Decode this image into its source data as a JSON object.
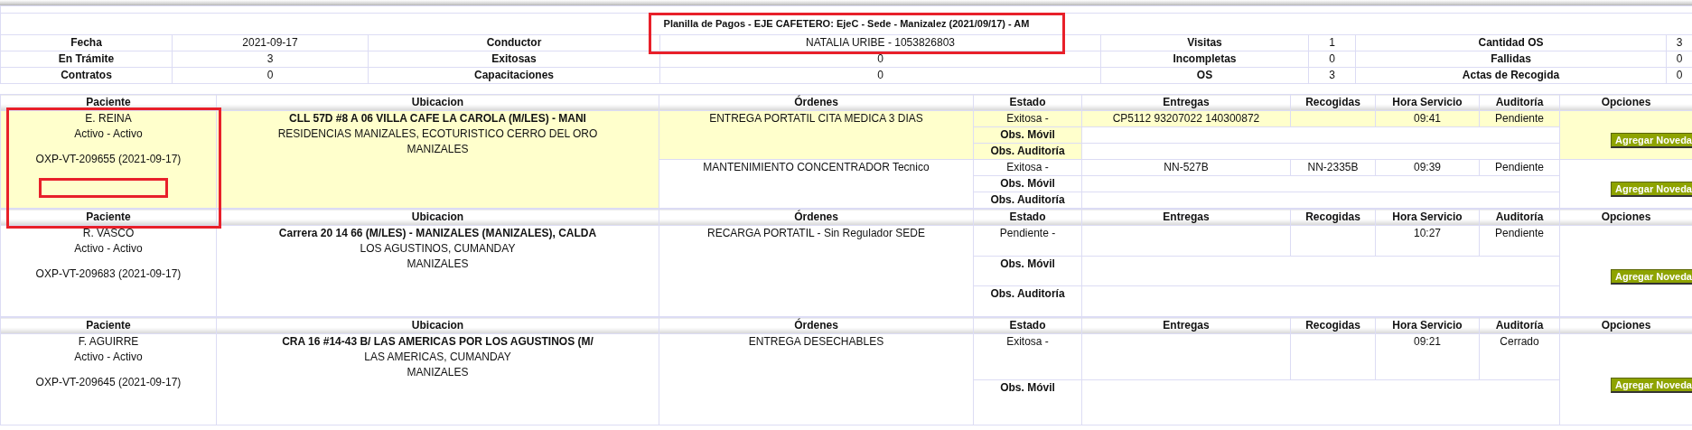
{
  "title": "Planilla de Pagos - EJE CAFETERO: EjeC - Sede - Manizalez (2021/09/17) - AM",
  "summary": [
    [
      {
        "label": "Fecha",
        "value": "2021-09-17"
      },
      {
        "label": "Conductor",
        "value": "NATALIA URIBE - 1053826803"
      },
      {
        "label": "Visitas",
        "value": "1"
      },
      {
        "label": "Cantidad OS",
        "value": "3"
      }
    ],
    [
      {
        "label": "En Trámite",
        "value": "3"
      },
      {
        "label": "Exitosas",
        "value": "0"
      },
      {
        "label": "Incompletas",
        "value": "0"
      },
      {
        "label": "Fallidas",
        "value": "0"
      }
    ],
    [
      {
        "label": "Contratos",
        "value": "0"
      },
      {
        "label": "Capacitaciones",
        "value": "0"
      },
      {
        "label": "OS",
        "value": "3"
      },
      {
        "label": "Actas de Recogida",
        "value": "0"
      }
    ]
  ],
  "groups": [
    {
      "highlighted": true,
      "columns": [
        "Paciente",
        "Ubicacion",
        "Órdenes",
        "Estado",
        "Entregas",
        "Recogidas",
        "Hora Servicio",
        "Auditoría",
        "Opciones"
      ],
      "patient": {
        "name": "E. REINA",
        "status": "Activo - Activo",
        "code": "OXP-VT-209655 (2021-09-17)"
      },
      "location": {
        "address": "CLL 57D #8 A 06 VILLA CAFE LA CAROLA (M/LES) - MANI",
        "area": "RESIDENCIAS MANIZALES, ECOTURISTICO CERRO DEL ORO",
        "city": "MANIZALES"
      },
      "orders": [
        {
          "highlighted": true,
          "description": "ENTREGA PORTATIL CITA MEDICA 3 DIAS",
          "estado": "Exitosa -",
          "entregas": "CP5112 93207022 140300872",
          "hora": "09:41",
          "auditoria": "Pendiente",
          "observations": [
            "Obs. Móvil",
            "Obs. Auditoría"
          ],
          "button": "Agregar Noveda"
        },
        {
          "highlighted": false,
          "description": "MANTENIMIENTO CONCENTRADOR Tecnico",
          "estado": "Exitosa -",
          "entregas": "NN-527B",
          "recogidas": "NN-2335B",
          "hora": "09:39",
          "auditoria": "Pendiente",
          "observations": [
            "Obs. Móvil",
            "Obs. Auditoría"
          ],
          "button": "Agregar Noveda"
        }
      ]
    },
    {
      "highlighted": false,
      "columns": [
        "Paciente",
        "Ubicacion",
        "Órdenes",
        "Estado",
        "Entregas",
        "Recogidas",
        "Hora Servicio",
        "Auditoría",
        "Opciones"
      ],
      "patient": {
        "name": "R. VASCO",
        "status": "Activo - Activo",
        "code": "OXP-VT-209683 (2021-09-17)"
      },
      "location": {
        "address": "Carrera 20 14 66 (M/LES) - MANIZALES (MANIZALES), CALDA",
        "area": "LOS AGUSTINOS, CUMANDAY",
        "city": "MANIZALES"
      },
      "orders": [
        {
          "highlighted": false,
          "description": "RECARGA PORTATIL - Sin Regulador SEDE",
          "estado": "Pendiente -",
          "hora": "10:27",
          "auditoria": "Pendiente",
          "observations": [
            "Obs. Móvil",
            "Obs. Auditoría"
          ],
          "button": "Agregar Noveda"
        }
      ]
    },
    {
      "highlighted": false,
      "columns": [
        "Paciente",
        "Ubicacion",
        "Órdenes",
        "Estado",
        "Entregas",
        "Recogidas",
        "Hora Servicio",
        "Auditoría",
        "Opciones"
      ],
      "patient": {
        "name": "F. AGUIRRE",
        "status": "Activo - Activo",
        "code": "OXP-VT-209645 (2021-09-17)"
      },
      "location": {
        "address": "CRA 16 #14-43 B/ LAS AMERICAS POR LOS AGUSTINOS (M/",
        "area": "LAS AMERICAS, CUMANDAY",
        "city": "MANIZALES"
      },
      "orders": [
        {
          "highlighted": false,
          "description": "ENTREGA DESECHABLES",
          "estado": "Exitosa -",
          "hora": "09:21",
          "auditoria": "Cerrado",
          "observations": [
            "Obs. Móvil"
          ],
          "button": "Agregar Noveda"
        }
      ]
    }
  ]
}
